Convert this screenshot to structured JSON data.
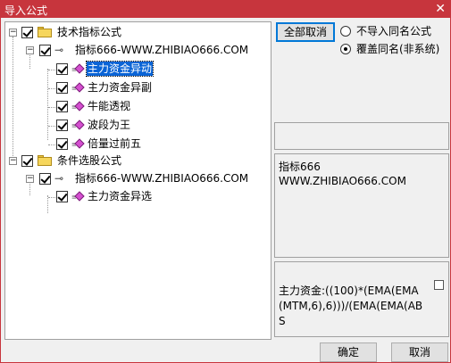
{
  "window": {
    "title": "导入公式",
    "close_glyph": "✕"
  },
  "tree": {
    "groups": [
      {
        "label": "技术指标公式",
        "expander": "−",
        "children": [
          {
            "label": "指标666-WWW.ZHIBIAO666.COM",
            "expander": "−",
            "items": [
              "主力资金异动",
              "主力资金异副",
              "牛能透视",
              "波段为王",
              "倍量过前五"
            ]
          }
        ]
      },
      {
        "label": "条件选股公式",
        "expander": "−",
        "children": [
          {
            "label": "指标666-WWW.ZHIBIAO666.COM",
            "expander": "−",
            "items": [
              "主力资金异选"
            ]
          }
        ]
      }
    ],
    "selected_item": "主力资金异动"
  },
  "options": {
    "deselect_all_label": "全部取消",
    "radio_no_import": "不导入同名公式",
    "radio_overwrite": "覆盖同名(非系统)",
    "selected_radio": "overwrite"
  },
  "info": {
    "line1": "指标666",
    "line2": "WWW.ZHIBIAO666.COM"
  },
  "formula": {
    "text": "主力资金:((100)*(EMA(EMA(MTM,6),6)))/(EMA(EMA(ABS"
  },
  "footer": {
    "ok_label": "确定",
    "cancel_label": "取消"
  },
  "colors": {
    "titlebar": "#c7353d",
    "selection": "#0a64d6"
  },
  "icons": {
    "group": "folder-icon",
    "source": "key-icon",
    "item": "formula-diamond-icon"
  }
}
